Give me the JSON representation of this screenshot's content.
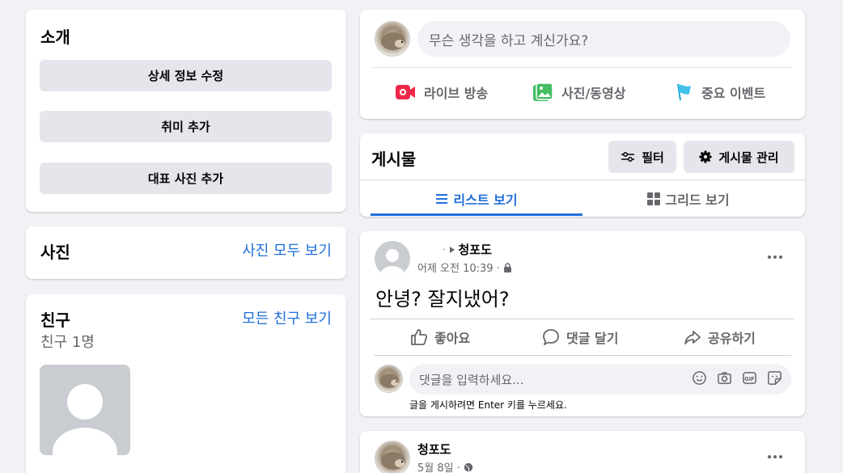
{
  "intro": {
    "title": "소개",
    "edit_details": "상세 정보 수정",
    "add_hobbies": "취미 추가",
    "add_featured": "대표 사진 추가"
  },
  "photos": {
    "title": "사진",
    "see_all": "사진 모두 보기"
  },
  "friends": {
    "title": "친구",
    "see_all": "모든 친구 보기",
    "count": "친구 1명"
  },
  "composer": {
    "placeholder": "무슨 생각을 하고 계신가요?",
    "live": "라이브 방송",
    "photo_video": "사진/동영상",
    "life_event": "중요 이벤트"
  },
  "posts_header": {
    "title": "게시물",
    "filter": "필터",
    "manage": "게시물 관리",
    "list_view": "리스트 보기",
    "grid_view": "그리드 보기"
  },
  "post1": {
    "author": "청포도",
    "time": "어제 오전 10:39 ·",
    "text": "안녕? 잘지냈어?",
    "like": "좋아요",
    "comment": "댓글 달기",
    "share": "공유하기",
    "comment_placeholder": "댓글을 입력하세요...",
    "enter_hint": "글을 게시하려면 Enter 키를 누르세요."
  },
  "post2": {
    "author": "청포도",
    "time": "5월 8일 ·"
  },
  "colors": {
    "accent": "#216fdb",
    "background": "#f0f2f5",
    "button_grey": "#e4e6eb"
  }
}
